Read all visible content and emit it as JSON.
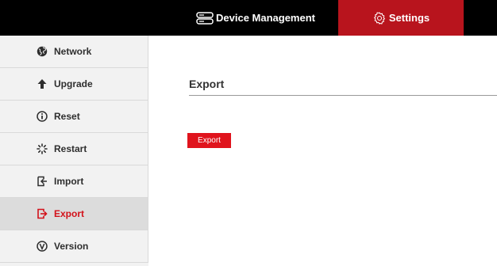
{
  "header": {
    "tabs": [
      {
        "label": "Device Management",
        "icon": "server-icon",
        "active": false
      },
      {
        "label": "Settings",
        "icon": "gear-icon",
        "active": true
      }
    ]
  },
  "sidebar": {
    "items": [
      {
        "label": "Network",
        "icon": "globe-icon",
        "active": false
      },
      {
        "label": "Upgrade",
        "icon": "arrow-up-icon",
        "active": false
      },
      {
        "label": "Reset",
        "icon": "info-icon",
        "active": false
      },
      {
        "label": "Restart",
        "icon": "spinner-icon",
        "active": false
      },
      {
        "label": "Import",
        "icon": "import-icon",
        "active": false
      },
      {
        "label": "Export",
        "icon": "export-icon",
        "active": true
      },
      {
        "label": "Version",
        "icon": "version-icon",
        "active": false
      }
    ]
  },
  "main": {
    "title": "Export",
    "export_button": "Export"
  },
  "colors": {
    "accent": "#d3111a",
    "topbar": "#000000",
    "settings_tab": "#b8141d",
    "sidebar_bg": "#f2f2f2",
    "sidebar_active_bg": "#dcdcdc"
  }
}
